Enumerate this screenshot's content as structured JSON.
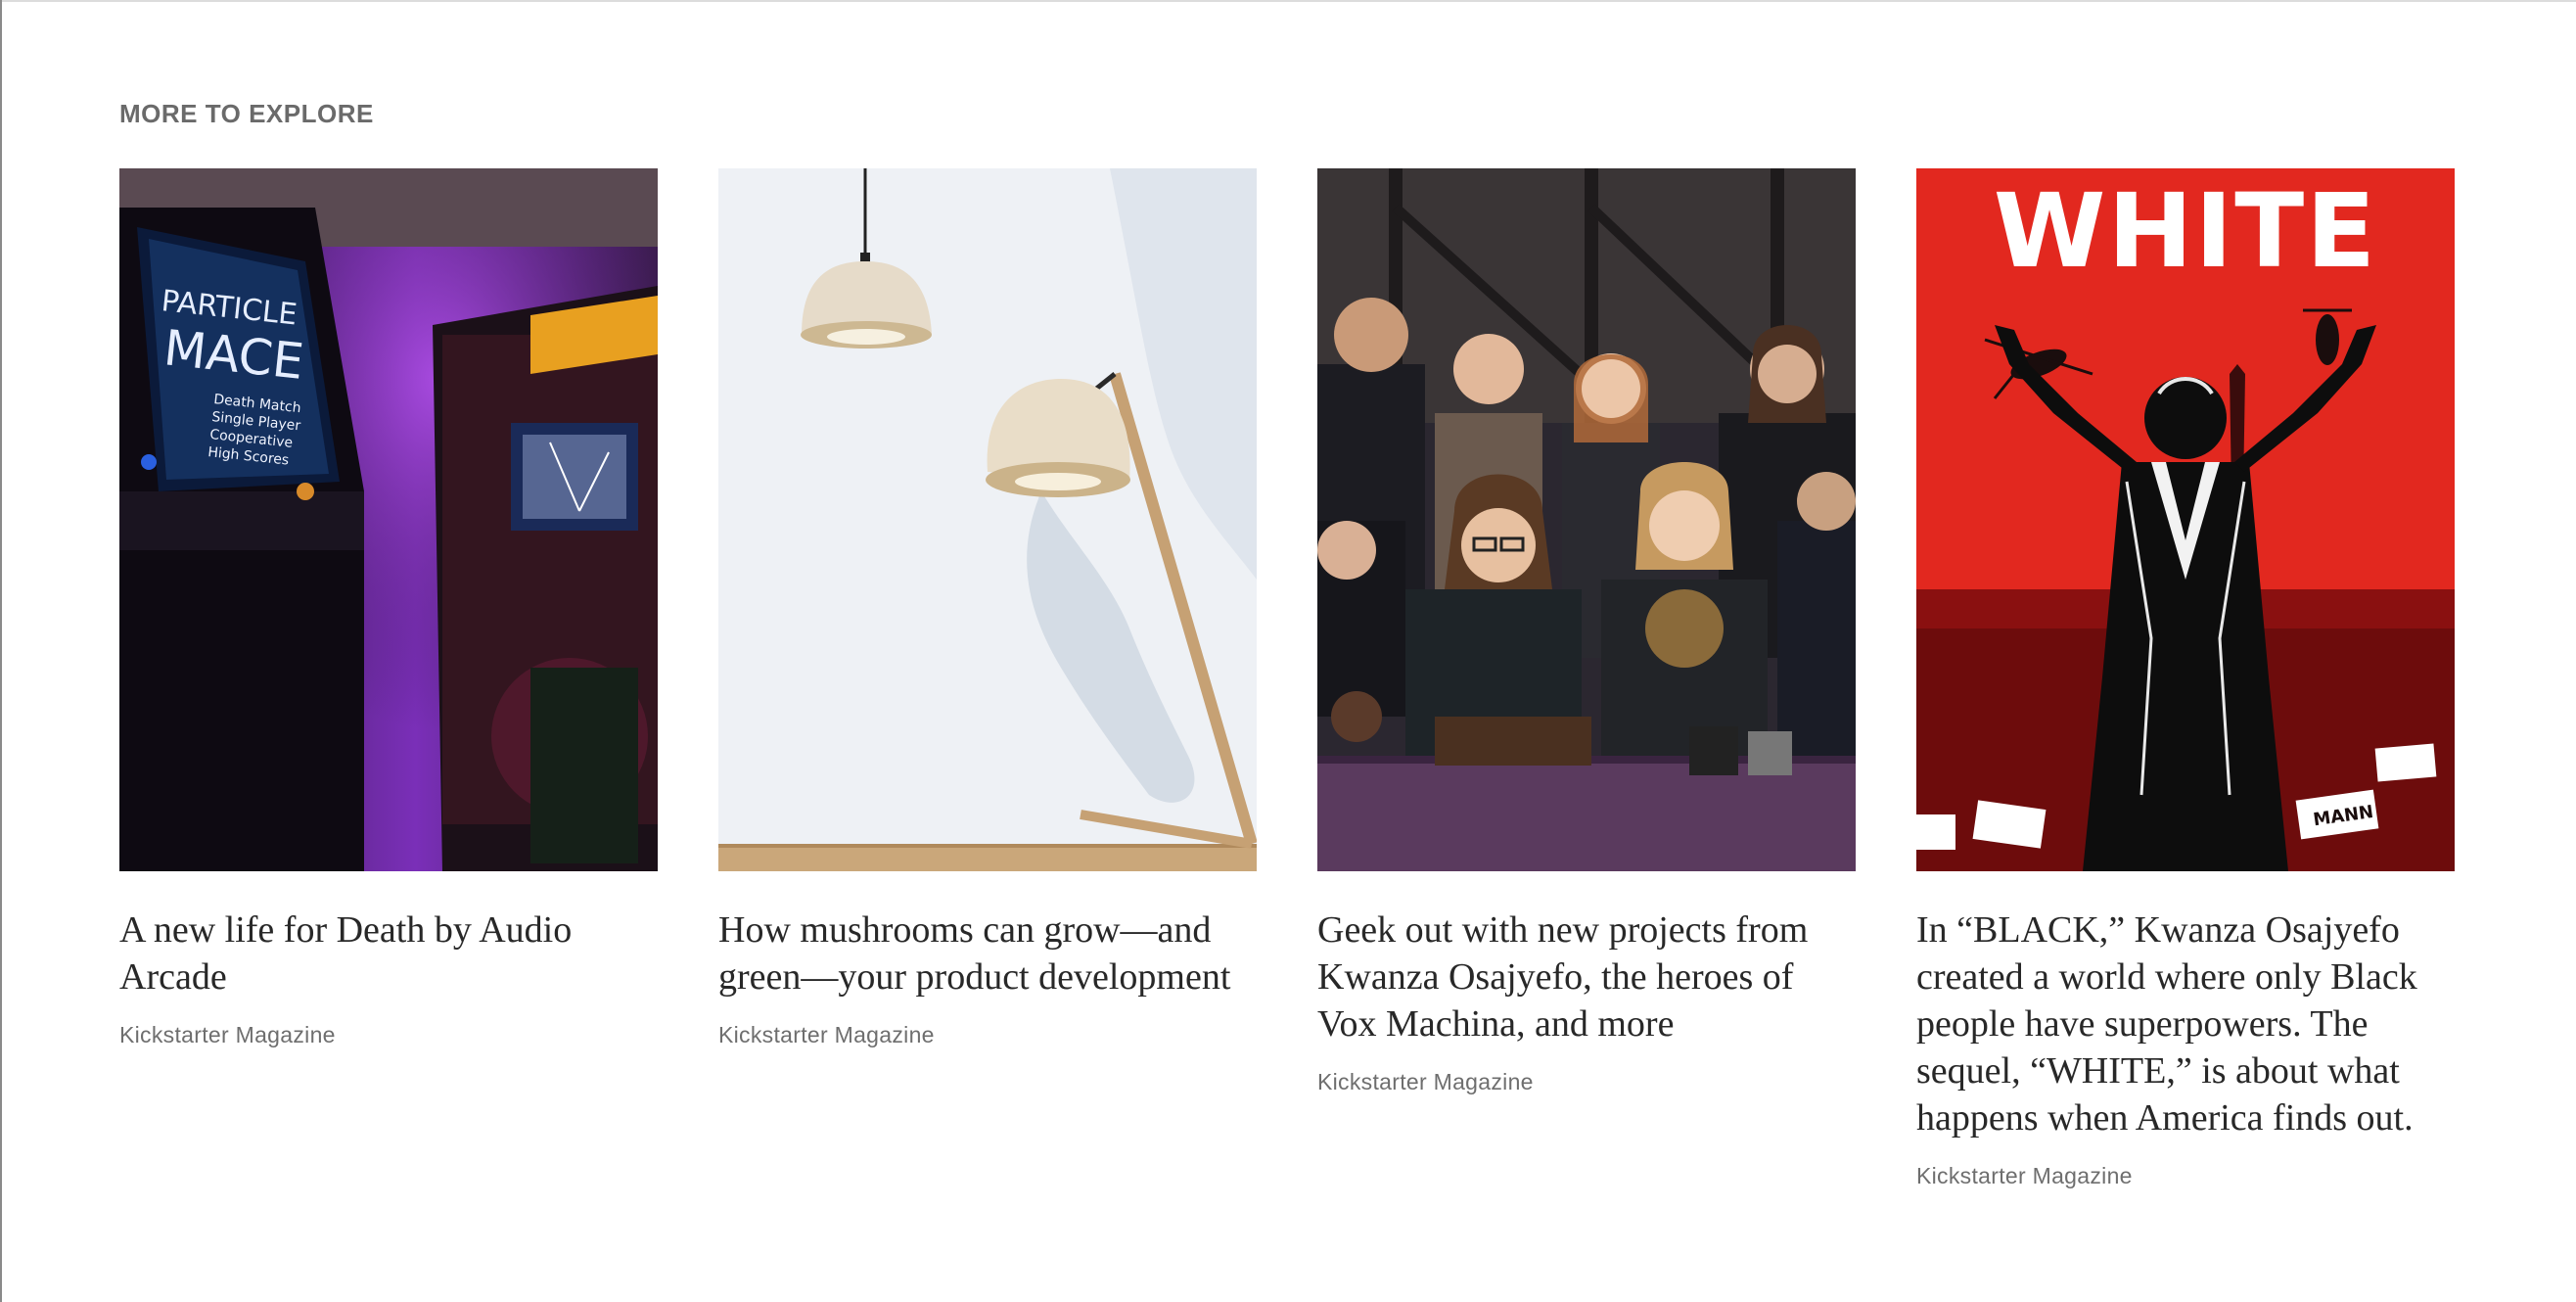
{
  "section": {
    "title": "MORE TO EXPLORE"
  },
  "cards": [
    {
      "title": "A new life for Death by Audio Arcade",
      "source": "Kickstarter Magazine",
      "image": "arcade-cabinets-photo",
      "screen_text": [
        "PARTICLE",
        "MACE",
        "Death Match",
        "Single Player",
        "Cooperative",
        "High Scores"
      ]
    },
    {
      "title": "How mushrooms can grow—and green—your product development",
      "source": "Kickstarter Magazine",
      "image": "mushroom-lamps-photo"
    },
    {
      "title": "Geek out with new projects from Kwanza Osajyefo, the heroes of Vox Machina, and more",
      "source": "Kickstarter Magazine",
      "image": "vox-machina-cast-photo"
    },
    {
      "title": "In “BLACK,” Kwanza Osajyefo created a world where only Black people have superpowers. The sequel, “WHITE,” is about what happens when America finds out.",
      "source": "Kickstarter Magazine",
      "image": "white-comic-cover",
      "cover_text": "WHITE",
      "sign_text": "MANN"
    }
  ]
}
